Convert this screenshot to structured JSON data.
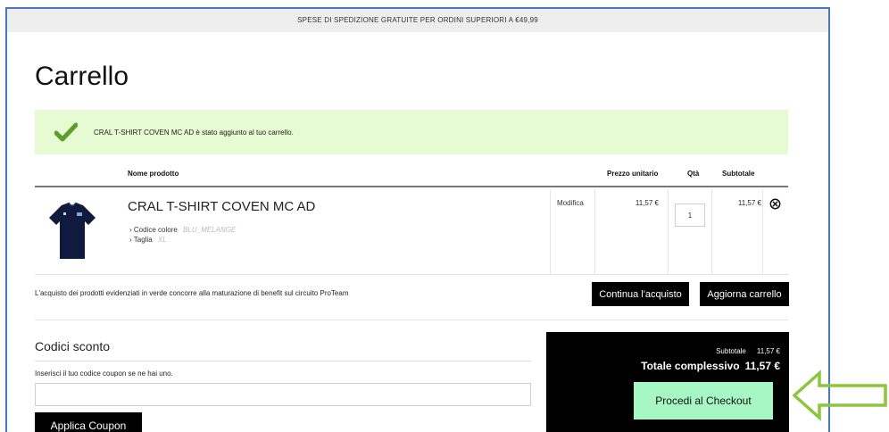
{
  "promo_banner": "SPESE DI SPEDIZIONE GRATUITE PER ORDINI SUPERIORI A €49,99",
  "page_title": "Carrello",
  "success_message": "CRAL T-SHIRT COVEN MC AD è stato aggiunto al tuo carrello.",
  "table": {
    "headers": {
      "name": "Nome prodotto",
      "unit_price": "Prezzo unitario",
      "qty": "Qtà",
      "subtotal": "Subtotale"
    },
    "item": {
      "name": "CRAL T-SHIRT COVEN MC AD",
      "options": [
        {
          "label": "Codice colore",
          "value": "BLU_MELANGE"
        },
        {
          "label": "Taglia",
          "value": "XL"
        }
      ],
      "edit_label": "Modifica",
      "unit_price": "11,57 €",
      "qty": "1",
      "subtotal": "11,57 €",
      "remove_icon": "circle-x-icon"
    }
  },
  "benefit_note": "L'acquisto dei prodotti evidenziati in verde concorre alla maturazione di benefit sul circuito ProTeam",
  "actions": {
    "continue_label": "Continua l'acquisto",
    "update_label": "Aggiorna carrello"
  },
  "coupon": {
    "title": "Codici sconto",
    "help": "Inserisci il tuo codice coupon se ne hai uno.",
    "value": "",
    "apply_label": "Applica Coupon"
  },
  "summary": {
    "subtotal_label": "Subtotale",
    "subtotal_value": "11,57 €",
    "total_label": "Totale complessivo",
    "total_value": "11,57 €",
    "checkout_label": "Procedi al Checkout"
  },
  "colors": {
    "success_bg": "#e7fbd3",
    "check_green": "#5c9e2e",
    "checkout_bg": "#a7f7c5",
    "arrow_green": "#8cc63f",
    "frame_border": "#4a78b8"
  }
}
